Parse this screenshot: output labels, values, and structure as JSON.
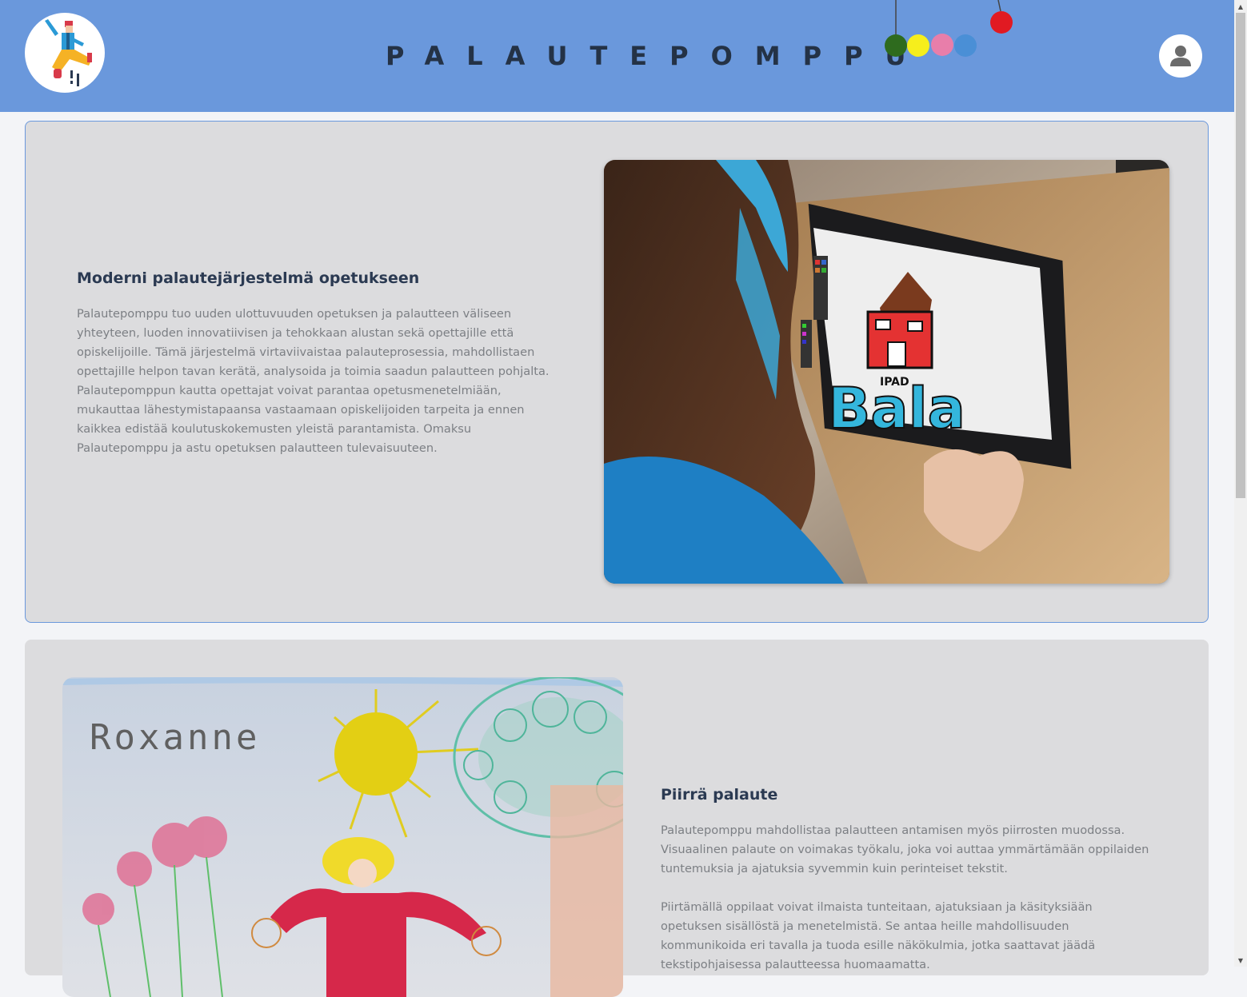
{
  "header": {
    "brand": "PALAUTEPOMPPU",
    "logo_icon": "jumping-person-logo",
    "user_icon": "user-avatar-icon",
    "dot_colors": [
      "#2e6b1e",
      "#f6ee1c",
      "#e87eaa",
      "#4a8fd6",
      "#e11a22"
    ],
    "background": "#6a98dc"
  },
  "sections": [
    {
      "title": "Moderni palautejärjestelmä opetukseen",
      "paragraphs": [
        "Palautepomppu tuo uuden ulottuvuuden opetuksen ja palautteen väliseen yhteyteen, luoden innovatiivisen ja tehokkaan alustan sekä opettajille että opiskelijoille. Tämä järjestelmä virtaviivaistaa palauteprosessia, mahdollistaen opettajille helpon tavan kerätä, analysoida ja toimia saadun palautteen pohjalta. Palautepomppun kautta opettajat voivat parantaa opetusmenetelmiään, mukauttaa lähestymistapaansa vastaamaan opiskelijoiden tarpeita ja ennen kaikkea edistää koulutuskokemusten yleistä parantamista. Omaksu Palautepomppu ja astu opetuksen palautteen tulevaisuuteen."
      ],
      "image": "child-drawing-on-tablet-photo",
      "tablet_drawing_text": [
        "IPAD",
        "Bala"
      ]
    },
    {
      "title": "Piirrä palaute",
      "paragraphs": [
        "Palautepomppu mahdollistaa palautteen antamisen myös piirrosten muodossa. Visuaalinen palaute on voimakas työkalu, joka voi auttaa ymmärtämään oppilaiden tuntemuksia ja ajatuksia syvemmin kuin perinteiset tekstit.",
        "Piirtämällä oppilaat voivat ilmaista tunteitaan, ajatuksiaan ja käsityksiään opetuksen sisällöstä ja menetelmistä. Se antaa heille mahdollisuuden kommunikoida eri tavalla ja tuoda esille näkökulmia, jotka saattavat jäädä tekstipohjaisessa palautteessa huomaamatta."
      ],
      "image": "child-crayon-drawing",
      "drawing_signature": "Roxanne"
    }
  ],
  "scrollbar": {
    "up_icon": "▲",
    "down_icon": "▼"
  }
}
